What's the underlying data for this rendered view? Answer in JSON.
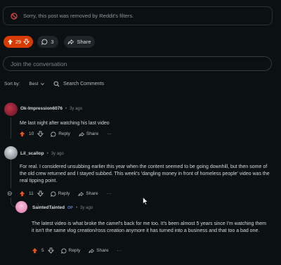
{
  "notice": {
    "text": "Sorry, this post was removed by Reddit's filters."
  },
  "post_actions": {
    "votes": "29",
    "comments": "3",
    "share": "Share"
  },
  "join": {
    "placeholder": "Join the conversation"
  },
  "sort": {
    "label": "Sort by:",
    "value": "Best",
    "search": "Search Comments"
  },
  "comments": [
    {
      "author": "Ok-Impression6076",
      "time": "3y ago",
      "text": "Me last night after watching his last video",
      "votes": "10",
      "reply": "Reply",
      "share": "Share",
      "more": "···"
    },
    {
      "author": "Lil_scallop",
      "time": "3y ago",
      "text": "For real. I considered unsubbing earlier this year when the content seemed to be going downhill, but then some of the old crew returned and I stayed subbed. This week's 'dangling money in front of homeless people' video was the real tipping point.",
      "votes": "11",
      "reply": "Reply",
      "share": "Share",
      "more": "···",
      "collapse": "⊖"
    },
    {
      "author": "SaintedTainted",
      "badge": "OP",
      "time": "3y ago",
      "text": "The latest video is what broke the camel's back for me too. It's been almost 5 years since I'm watching them it isn't the same vlog creation/ross creation anymore it has turned into a business and that too a bad one.",
      "votes": "5",
      "reply": "Reply",
      "share": "Share",
      "more": "···"
    }
  ],
  "colors": {
    "accent": "#d93a00",
    "background": "#0b1012",
    "op_badge": "#4f86d6"
  }
}
